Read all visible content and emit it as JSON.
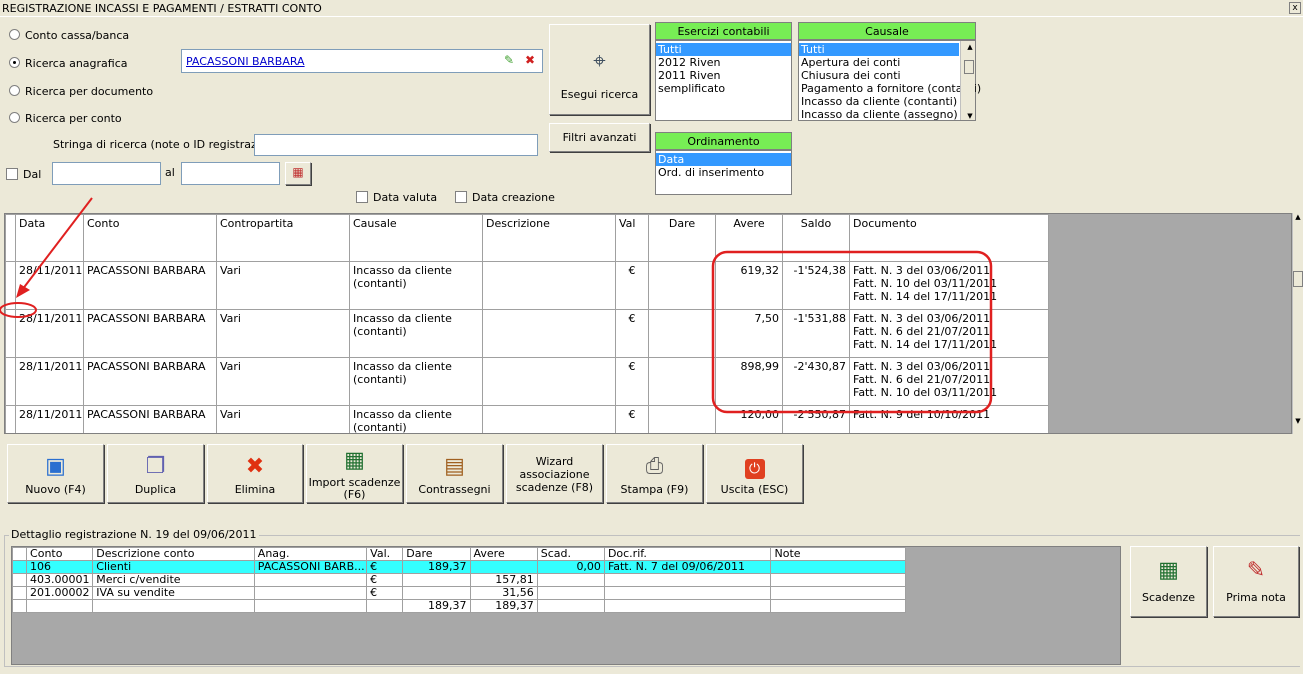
{
  "window": {
    "title": "REGISTRAZIONE INCASSI E PAGAMENTI / ESTRATTI CONTO",
    "close": "x"
  },
  "search": {
    "radio_conto": "Conto cassa/banca",
    "radio_anagrafica": "Ricerca anagrafica",
    "radio_documento": "Ricerca per documento",
    "radio_perconto": "Ricerca per conto",
    "anagrafica_value": "PACASSONI BARBARA",
    "stringa_label": "Stringa di ricerca (note o ID registrazione)",
    "stringa_value": "",
    "dal_label": "Dal",
    "al_label": "al",
    "dal_value": "",
    "al_value": "",
    "data_valuta": "Data valuta",
    "data_creazione": "Data creazione",
    "esegui": "Esegui ricerca",
    "filtri": "Filtri avanzati"
  },
  "esercizi": {
    "header": "Esercizi contabili",
    "items": [
      "Tutti",
      "2012 Riven",
      "2011 Riven",
      "semplificato"
    ]
  },
  "causale": {
    "header": "Causale",
    "items": [
      "Tutti",
      "Apertura dei conti",
      "Chiusura dei conti",
      "Pagamento a fornitore (contanti)",
      "Incasso da cliente (contanti)",
      "Incasso da cliente (assegno)"
    ]
  },
  "ordinamento": {
    "header": "Ordinamento",
    "items": [
      "Data",
      "Ord. di inserimento"
    ]
  },
  "grid": {
    "headers": [
      "Data",
      "Conto",
      "Contropartita",
      "Causale",
      "Descrizione",
      "Val",
      "Dare",
      "Avere",
      "Saldo",
      "Documento"
    ],
    "rows": [
      {
        "data": "28/11/2011",
        "conto": "PACASSONI BARBARA",
        "contro": "Vari",
        "causale1": "Incasso da cliente",
        "causale2": "(contanti)",
        "desc": "",
        "val": "€",
        "dare": "",
        "avere": "619,32",
        "saldo": "-1'524,38",
        "doc": [
          "Fatt. N. 3 del 03/06/2011",
          "Fatt. N. 10 del 03/11/2011",
          "Fatt. N. 14 del 17/11/2011"
        ]
      },
      {
        "data": "28/11/2011",
        "conto": "PACASSONI BARBARA",
        "contro": "Vari",
        "causale1": "Incasso da cliente",
        "causale2": "(contanti)",
        "desc": "",
        "val": "€",
        "dare": "",
        "avere": "7,50",
        "saldo": "-1'531,88",
        "doc": [
          "Fatt. N. 3 del 03/06/2011",
          "Fatt. N. 6 del 21/07/2011",
          "Fatt. N. 14 del 17/11/2011"
        ]
      },
      {
        "data": "28/11/2011",
        "conto": "PACASSONI BARBARA",
        "contro": "Vari",
        "causale1": "Incasso da cliente",
        "causale2": "(contanti)",
        "desc": "",
        "val": "€",
        "dare": "",
        "avere": "898,99",
        "saldo": "-2'430,87",
        "doc": [
          "Fatt. N. 3 del 03/06/2011",
          "Fatt. N. 6 del 21/07/2011",
          "Fatt. N. 10 del 03/11/2011"
        ]
      },
      {
        "data": "28/11/2011",
        "conto": "PACASSONI BARBARA",
        "contro": "Vari",
        "causale1": "Incasso da cliente",
        "causale2": "(contanti)",
        "desc": "",
        "val": "€",
        "dare": "",
        "avere": "120,00",
        "saldo": "-2'550,87",
        "doc": [
          "Fatt. N. 9 del 10/10/2011"
        ]
      }
    ]
  },
  "toolbar": {
    "nuovo": "Nuovo (F4)",
    "duplica": "Duplica",
    "elimina": "Elimina",
    "import1": "Import scadenze",
    "import2": "(F6)",
    "contrassegni": "Contrassegni",
    "wizard1": "Wizard",
    "wizard2": "associazione",
    "wizard3": "scadenze (F8)",
    "stampa": "Stampa (F9)",
    "uscita": "Uscita (ESC)"
  },
  "detail": {
    "legend": "Dettaglio registrazione N. 19 del 09/06/2011",
    "headers": [
      "Conto",
      "Descrizione conto",
      "Anag.",
      "Val.",
      "Dare",
      "Avere",
      "Scad.",
      "Doc.rif.",
      "Note"
    ],
    "rows": [
      [
        "106",
        "Clienti",
        "PACASSONI BARB...",
        "€",
        "189,37",
        "",
        "0,00",
        "Fatt. N. 7 del 09/06/2011",
        ""
      ],
      [
        "403.00001",
        "Merci c/vendite",
        "",
        "€",
        "",
        "157,81",
        "",
        "",
        ""
      ],
      [
        "201.00002",
        "IVA su vendite",
        "",
        "€",
        "",
        "31,56",
        "",
        "",
        ""
      ],
      [
        "",
        "",
        "",
        "",
        "189,37",
        "189,37",
        "",
        "",
        ""
      ]
    ],
    "scadenze": "Scadenze",
    "prima_nota": "Prima nota"
  },
  "colors": {
    "green_header": "#77ee55",
    "selection": "#3399ff",
    "highlight_row": "#33ffff",
    "annotation": "#e02020"
  }
}
